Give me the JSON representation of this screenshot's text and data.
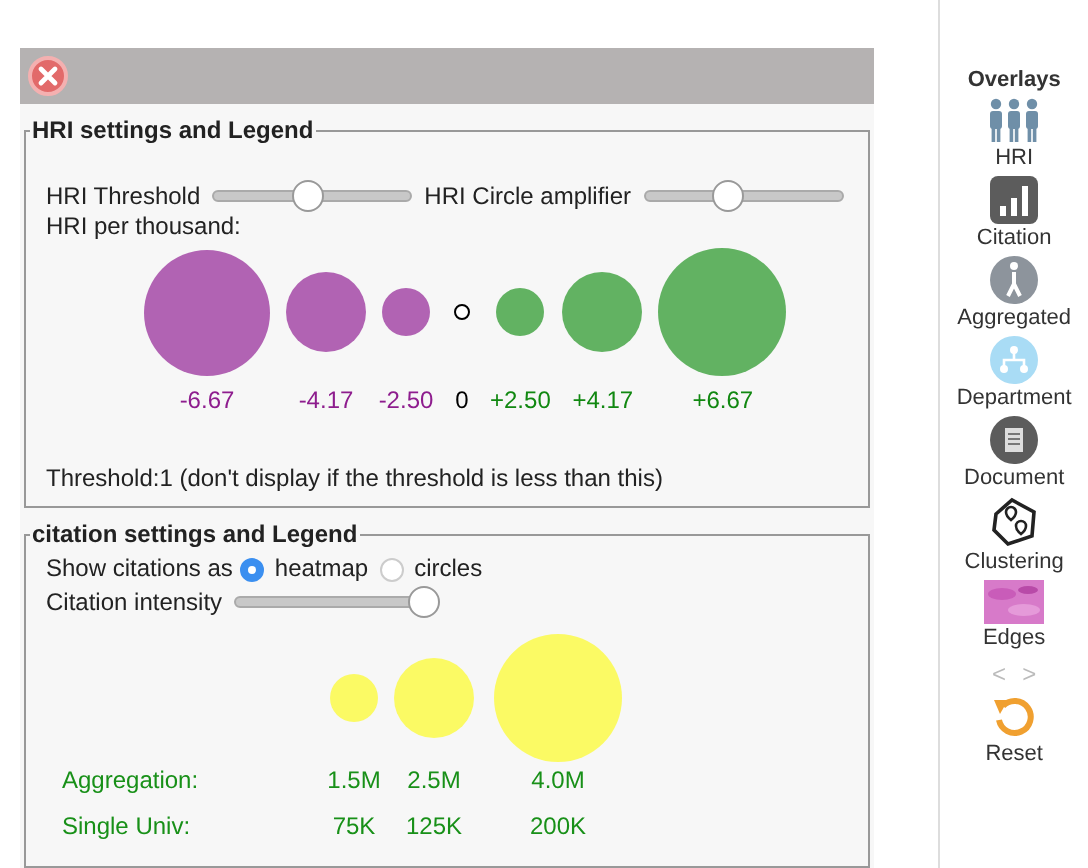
{
  "hri": {
    "legend": "HRI settings and Legend",
    "sliders": [
      {
        "label": "HRI Threshold",
        "level": 0.48
      },
      {
        "label": "HRI Circle amplifier",
        "level": 0.42
      }
    ],
    "caption": "HRI per thousand:",
    "circles": [
      {
        "label": "-6.67",
        "kind": "negative"
      },
      {
        "label": "-4.17",
        "kind": "negative"
      },
      {
        "label": "-2.50",
        "kind": "negative"
      },
      {
        "label": "0",
        "kind": "zero"
      },
      {
        "label": "+2.50",
        "kind": "positive"
      },
      {
        "label": "+4.17",
        "kind": "positive"
      },
      {
        "label": "+6.67",
        "kind": "positive"
      }
    ],
    "note": "Threshold:1 (don't display if the threshold is less than this)"
  },
  "citation": {
    "legend": "citation settings and Legend",
    "show_as": "Show citations as",
    "options": [
      {
        "label": "heatmap",
        "selected": true
      },
      {
        "label": "circles",
        "selected": false
      }
    ],
    "slider": {
      "label": "Citation intensity",
      "level": 0.95
    },
    "rows": [
      {
        "label": "Aggregation:",
        "values": [
          "1.5M",
          "2.5M",
          "4.0M"
        ]
      },
      {
        "label": "Single Univ:",
        "values": [
          "75K",
          "125K",
          "200K"
        ]
      }
    ]
  },
  "sidebar": {
    "title": "Overlays",
    "items": [
      {
        "label": "HRI"
      },
      {
        "label": "Citation"
      },
      {
        "label": "Aggregated"
      },
      {
        "label": "Department"
      },
      {
        "label": "Document"
      },
      {
        "label": "Clustering"
      },
      {
        "label": "Edges"
      }
    ],
    "pager": {
      "prev": "<",
      "next": ">"
    },
    "reset": {
      "label": "Reset"
    }
  }
}
